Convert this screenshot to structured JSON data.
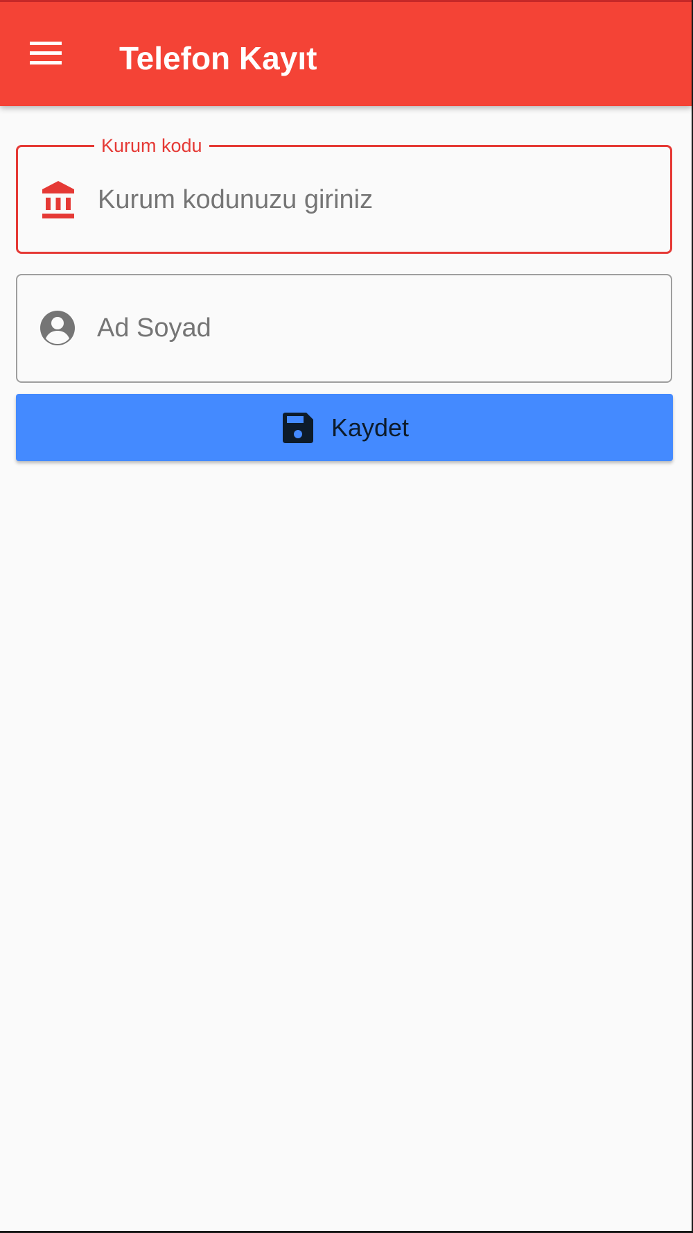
{
  "app_bar": {
    "title": "Telefon Kayıt",
    "menu_icon": "menu-icon",
    "background_color": "#f44336"
  },
  "form": {
    "kurum_field": {
      "label": "Kurum kodu",
      "placeholder": "Kurum kodunuzu giriniz",
      "value": "",
      "icon": "bank-icon",
      "state": "focused",
      "accent_color": "#e53935"
    },
    "name_field": {
      "placeholder": "Ad Soyad",
      "value": "",
      "icon": "account-circle-icon"
    },
    "save_button": {
      "label": "Kaydet",
      "icon": "save-icon",
      "background_color": "#448aff"
    }
  }
}
